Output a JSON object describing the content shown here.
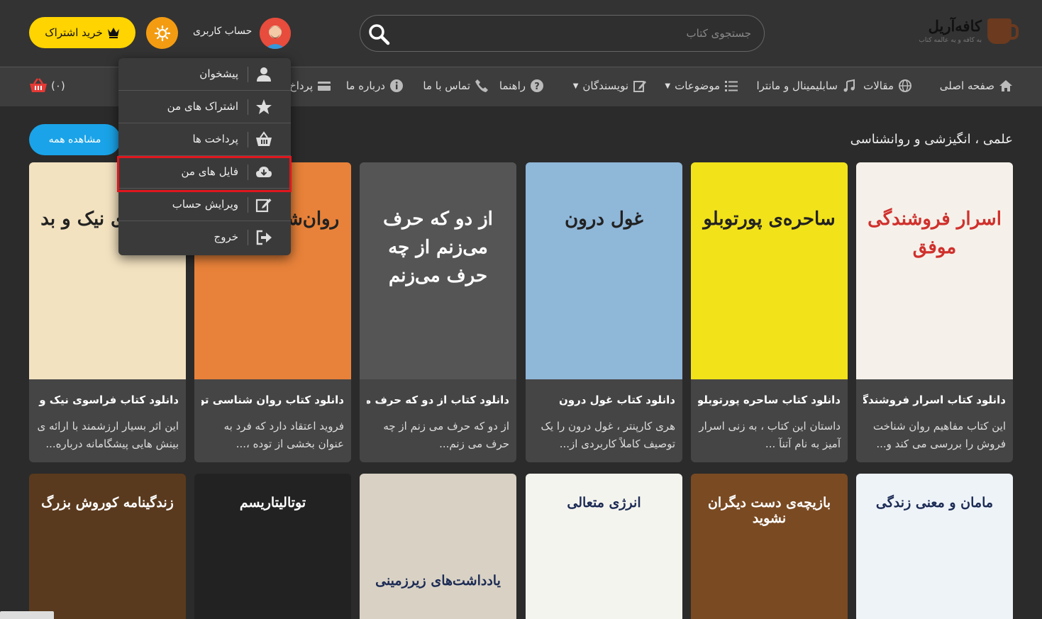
{
  "header": {
    "logo_name": "کافه‌آریل",
    "logo_tagline": "به کافه و یه عالمه کتاب",
    "search_placeholder": "جستجوی کتاب",
    "account_label": "حساب کاربری",
    "subscribe_label": "خرید اشتراک",
    "colors": {
      "accent": "#ffd400",
      "theme_toggle": "#f39c12",
      "button_blue": "#1aa3e8"
    }
  },
  "nav": {
    "items": [
      {
        "label": "صفحه اصلی",
        "icon": "home-icon"
      },
      {
        "label": "مقالات",
        "icon": "globe-icon"
      },
      {
        "label": "سابلیمینال و مانترا",
        "icon": "music-icon"
      },
      {
        "label": "موضوعات",
        "icon": "list-icon"
      },
      {
        "label": "نویسندگان",
        "icon": "edit-icon"
      },
      {
        "label": "راهنما",
        "icon": "question-icon"
      },
      {
        "label": "تماس با ما",
        "icon": "phone-icon"
      },
      {
        "label": "درباره ما",
        "icon": "info-icon"
      },
      {
        "label": "پرداخ",
        "icon": "card-icon"
      }
    ],
    "cart_count": "(۰)"
  },
  "dropdown": {
    "items": [
      {
        "label": "پیشخوان",
        "icon": "user-icon"
      },
      {
        "label": "اشتراک های من",
        "icon": "star-icon"
      },
      {
        "label": "پرداخت ها",
        "icon": "basket-icon"
      },
      {
        "label": "فایل های من",
        "icon": "cloud-download-icon"
      },
      {
        "label": "ویرایش حساب",
        "icon": "edit-icon"
      },
      {
        "label": "خروج",
        "icon": "sign-out-icon"
      }
    ]
  },
  "section": {
    "title": "علمی ، انگیزشی و روانشناسی",
    "view_all": "مشاهده همه"
  },
  "books": [
    {
      "title": "دانلود کتاب اسرار فروشندگی ...",
      "desc": "این کتاب مفاهیم روان شناخت فروش را بررسی می کند و...",
      "cover_title": "اسرار فروشندگی موفق",
      "cover_bg": "#f5f1ea"
    },
    {
      "title": "دانلود کتاب ساحره پورتوبلو",
      "desc": "داستان این کتاب ، به زنی اسرار آمیز به نام آتنآ ...",
      "cover_title": "ساحره‌ی پورتوبلو",
      "cover_bg": "#f2e21a"
    },
    {
      "title": "دانلود کتاب غول درون",
      "desc": "هری کارپنتر ، غول درون را یک توصیف کاملاً کاربردی از...",
      "cover_title": "غول درون",
      "cover_bg": "#8fb7d8"
    },
    {
      "title": "دانلود کتاب از دو که حرف مـ...",
      "desc": "از دو که حرف می زنم از چه حرف می زنم...",
      "cover_title": "از دو که حرف می‌زنم از چه حرف می‌زنم",
      "cover_bg": "#555555"
    },
    {
      "title": "دانلود کتاب روان شناسی تود...",
      "desc": "فروید اعتقاد دارد که فرد به عنوان بخشی از توده ،...",
      "cover_title": "روان‌شناسی توده",
      "cover_bg": "#e8823a"
    },
    {
      "title": "دانلود کتاب فراسوی نیک و بد",
      "desc": "این اثر بسیار ارزشمند با ارائه ی بینش هایی پیشگامانه درباره...",
      "cover_title": "فراسوی نیک و بد",
      "cover_bg": "#f3e2c0"
    }
  ],
  "books_row2": [
    {
      "cover_title": "مامان و معنی زندگی",
      "cover_bg": "#eef3f8"
    },
    {
      "cover_title": "بازیچه‌ی دست دیگران نشوید",
      "cover_bg": "#7a4a22"
    },
    {
      "cover_title": "انرژی متعالی",
      "cover_bg": "#f4f4ee"
    },
    {
      "cover_title": "یادداشت‌های زیرزمینی",
      "cover_bg": "#d9d2c4"
    },
    {
      "cover_title": "توتالیتاریسم",
      "cover_bg": "#222222"
    },
    {
      "cover_title": "زندگینامه کوروش بزرگ",
      "cover_bg": "#5a3a1e"
    }
  ]
}
